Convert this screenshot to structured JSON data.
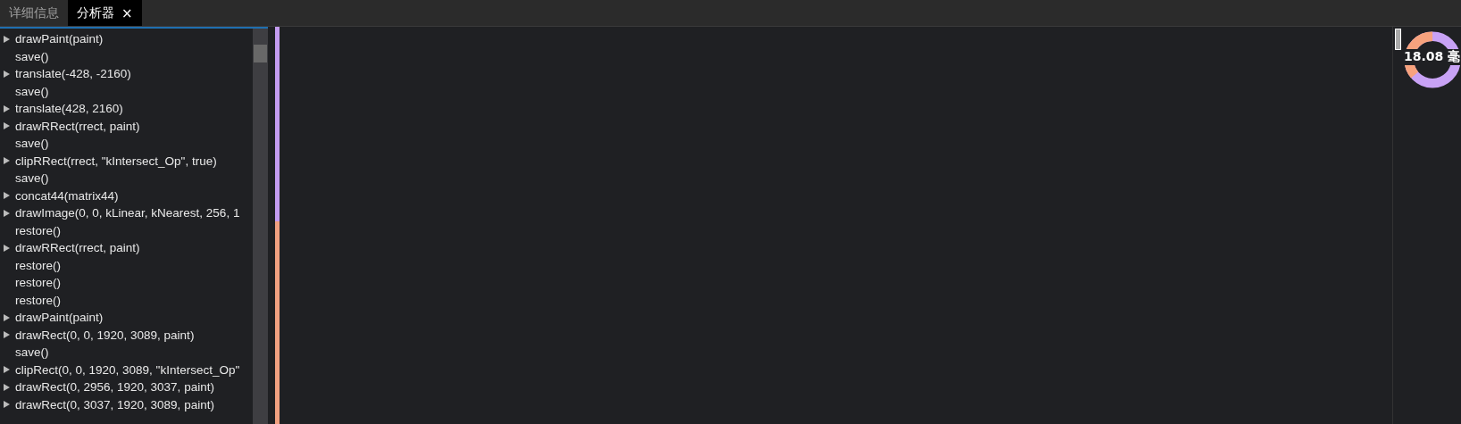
{
  "tabs": [
    {
      "label": "详细信息",
      "selected": false,
      "closable": false
    },
    {
      "label": "分析器",
      "selected": true,
      "closable": true,
      "close_glyph": "×"
    }
  ],
  "commands": [
    {
      "text": "drawPaint(paint)",
      "expandable": true
    },
    {
      "text": "save()",
      "expandable": false
    },
    {
      "text": "translate(-428, -2160)",
      "expandable": true
    },
    {
      "text": "save()",
      "expandable": false
    },
    {
      "text": "translate(428, 2160)",
      "expandable": true
    },
    {
      "text": "drawRRect(rrect, paint)",
      "expandable": true
    },
    {
      "text": "save()",
      "expandable": false
    },
    {
      "text": "clipRRect(rrect, \"kIntersect_Op\", true)",
      "expandable": true
    },
    {
      "text": "save()",
      "expandable": false
    },
    {
      "text": "concat44(matrix44)",
      "expandable": true
    },
    {
      "text": "drawImage(0, 0, kLinear, kNearest, 256, 1",
      "expandable": true
    },
    {
      "text": "restore()",
      "expandable": false
    },
    {
      "text": "drawRRect(rrect, paint)",
      "expandable": true
    },
    {
      "text": "restore()",
      "expandable": false
    },
    {
      "text": "restore()",
      "expandable": false
    },
    {
      "text": "restore()",
      "expandable": false
    },
    {
      "text": "drawPaint(paint)",
      "expandable": true
    },
    {
      "text": "drawRect(0, 0, 1920, 3089, paint)",
      "expandable": true
    },
    {
      "text": "save()",
      "expandable": false
    },
    {
      "text": "clipRect(0, 0, 1920, 3089, \"kIntersect_Op\"",
      "expandable": true
    },
    {
      "text": "drawRect(0, 2956, 1920, 3037, paint)",
      "expandable": true
    },
    {
      "text": "drawRect(0, 3037, 1920, 3089, paint)",
      "expandable": true
    }
  ],
  "frame_time": {
    "label": "18.08 毫"
  }
}
